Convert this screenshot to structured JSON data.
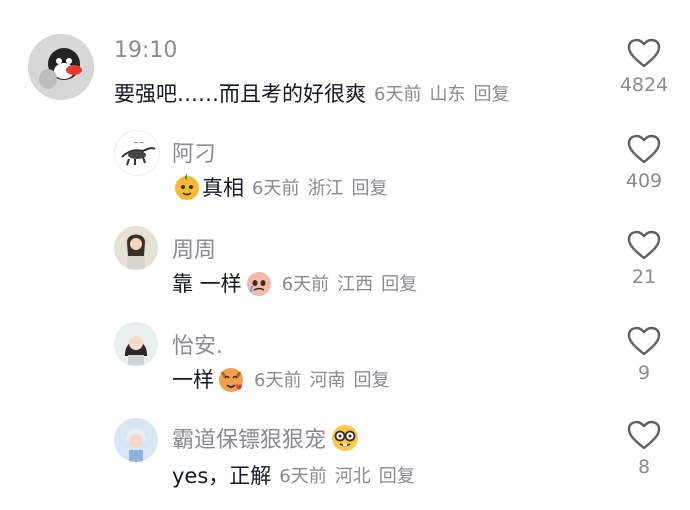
{
  "comments": [
    {
      "name": "19:10",
      "text": "要强吧……而且考的好很爽",
      "time": "6天前",
      "location": "山东",
      "reply": "回复",
      "likes": "4824",
      "avatar": "penguin-plush-avatar",
      "color": "#cccccc"
    },
    {
      "name": "阿刁",
      "text": "真相",
      "time": "6天前",
      "location": "浙江",
      "reply": "回复",
      "likes": "409",
      "avatar": "sketch-animal-avatar",
      "prefix_emoji": "mango-face-emoji"
    },
    {
      "name": "周周",
      "text": "靠 一样",
      "time": "6天前",
      "location": "江西",
      "reply": "回复",
      "likes": "21",
      "avatar": "girl-photo-avatar",
      "suffix_emoji": "crying-face-emoji"
    },
    {
      "name": "怡安.",
      "text": "一样",
      "time": "6天前",
      "location": "河南",
      "reply": "回复",
      "likes": "9",
      "avatar": "girl-photo-avatar",
      "suffix_emoji": "tiger-heart-emoji"
    },
    {
      "name": "霸道保镖狠狠宠",
      "text": "yes，正解",
      "time": "6天前",
      "location": "河北",
      "reply": "回复",
      "likes": "8",
      "avatar": "boy-photo-avatar",
      "name_emoji": "nerd-face-emoji"
    }
  ]
}
